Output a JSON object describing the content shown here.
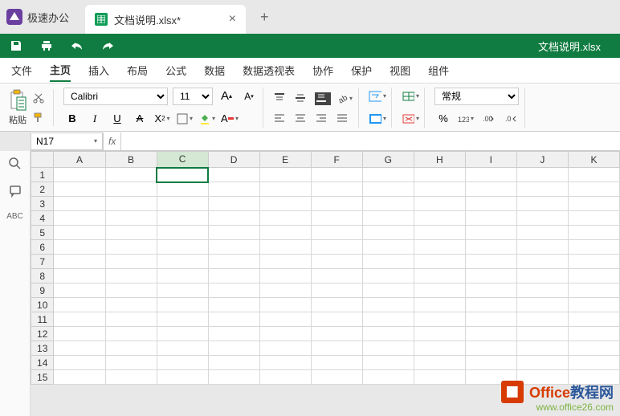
{
  "app": {
    "name": "极速办公"
  },
  "tab": {
    "title": "文档说明.xlsx*"
  },
  "doc_title": "文档说明.xlsx",
  "menus": [
    "文件",
    "主页",
    "插入",
    "布局",
    "公式",
    "数据",
    "数据透视表",
    "协作",
    "保护",
    "视图",
    "组件"
  ],
  "active_menu": 1,
  "ribbon": {
    "paste_label": "粘贴",
    "font_name": "Calibri",
    "font_size": "11",
    "number_format": "常规",
    "percent": "%"
  },
  "name_box": "N17",
  "fx_label": "fx",
  "columns": [
    "A",
    "B",
    "C",
    "D",
    "E",
    "F",
    "G",
    "H",
    "I",
    "J",
    "K"
  ],
  "selected_col": 2,
  "rows": [
    1,
    2,
    3,
    4,
    5,
    6,
    7,
    8,
    9,
    10,
    11,
    12,
    13,
    14,
    15
  ],
  "watermark": {
    "title": "Office教程网",
    "url": "www.office26.com"
  }
}
